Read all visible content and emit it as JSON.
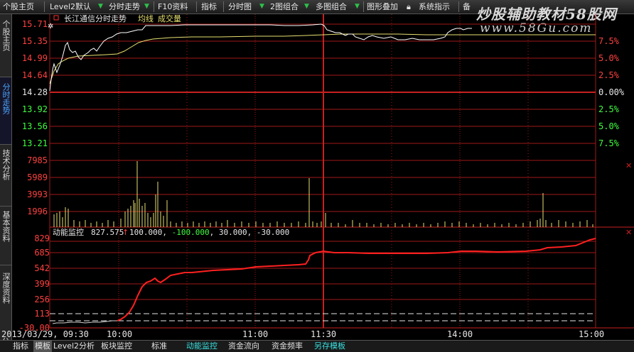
{
  "toolbar": {
    "items": [
      {
        "label": "个股主页",
        "arrow": false
      },
      {
        "label": "Level2默认",
        "arrow": true
      },
      {
        "label": "分时走势",
        "arrow": true
      },
      {
        "label": "F10资料",
        "arrow": false
      },
      {
        "label": "指标",
        "arrow": false
      },
      {
        "label": "分时图",
        "arrow": true
      },
      {
        "label": "2图组合",
        "arrow": true
      },
      {
        "label": "多图组合",
        "arrow": true
      },
      {
        "label": "图形叠加",
        "arrow": false
      },
      {
        "label": "系统指示",
        "arrow": false
      },
      {
        "label": "备",
        "arrow": false
      }
    ],
    "lock_icon": "lock-icon"
  },
  "watermark": {
    "line1": "炒股辅助教材58股网",
    "line2": "www.58Gu.com"
  },
  "side_tabs": [
    {
      "label": "个股主页",
      "active": false
    },
    {
      "label": "分时走势",
      "active": true
    },
    {
      "label": "技术分析",
      "active": false
    },
    {
      "label": "基本资料",
      "active": false
    },
    {
      "label": "深度资料",
      "active": false
    },
    {
      "label": "分",
      "active": false
    }
  ],
  "price_panel": {
    "title": "长江通信分时走势",
    "legend_avg": "均线",
    "legend_vol": "成交量",
    "price_labels": [
      "15.71",
      "15.35",
      "14.99",
      "14.64",
      "14.28",
      "13.92",
      "13.56",
      "13.21"
    ],
    "pct_labels": [
      "7.5%",
      "5.0%",
      "2.5%",
      "0.00%",
      "2.5%",
      "5.0%",
      "7.5%"
    ],
    "volume_labels": [
      "7985",
      "5989",
      "3993",
      "1996"
    ]
  },
  "indicator_panel": {
    "name": "动能监控",
    "value": "827.575",
    "arrow": "↑",
    "params": [
      "100.000",
      "-100.000",
      "30.000",
      "-30.000"
    ],
    "y_labels": [
      "829",
      "685",
      "542",
      "399",
      "256",
      "113",
      "-30.00"
    ]
  },
  "time_axis": {
    "date_label": "2013/03/29, 09:30",
    "labels": [
      "10:00",
      "11:00",
      "11:30",
      "14:00",
      "15:00"
    ]
  },
  "bottom_tabs": [
    {
      "label": "指标",
      "style": "normal"
    },
    {
      "label": "模板",
      "style": "normal"
    },
    {
      "label": "Level2分析",
      "style": "normal"
    },
    {
      "label": "板块监控",
      "style": "normal"
    },
    {
      "label": "标准",
      "style": "normal"
    },
    {
      "label": "动能监控",
      "style": "cyan"
    },
    {
      "label": "资金流向",
      "style": "normal"
    },
    {
      "label": "资金频率",
      "style": "normal"
    },
    {
      "label": "另存模板",
      "style": "cyan"
    }
  ],
  "colors": {
    "grid": "#a01818",
    "price_line": "#ffffff",
    "avg_line": "#e8e070",
    "up_text": "#ff4040",
    "down_text": "#40ff40",
    "indicator_line": "#ff2020",
    "volume_bar": "#e8e070"
  }
}
